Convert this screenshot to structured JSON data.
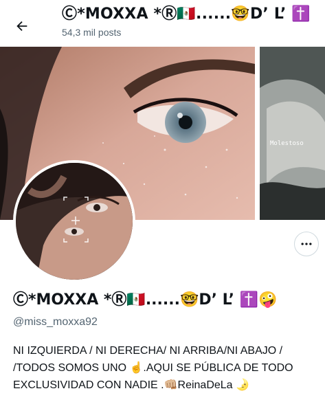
{
  "header": {
    "title": "Ⓒ*MOXXA *Ⓡ🇲🇽......🤓D’ L’ ✝️",
    "post_count": "54,3 mil posts"
  },
  "banner": {
    "side_caption": "Molestoso"
  },
  "profile": {
    "display_name": "Ⓒ*MOXXA *Ⓡ🇲🇽......🤓D’ L’ ✝️🤪",
    "handle": "@miss_moxxa92",
    "bio_lines": [
      "NI IZQUIERDA / NI DERECHA/ NI ARRIBA/NI ABAJO /",
      "/TODOS SOMOS UNO ☝️.AQUI SE PÚBLICA DE TODO",
      "EXCLUSIVIDAD CON NADIE .👊🏼ReinaDeLa 🌛"
    ]
  },
  "icons": {
    "back": "arrow-left-icon",
    "more": "more-horizontal-icon"
  }
}
